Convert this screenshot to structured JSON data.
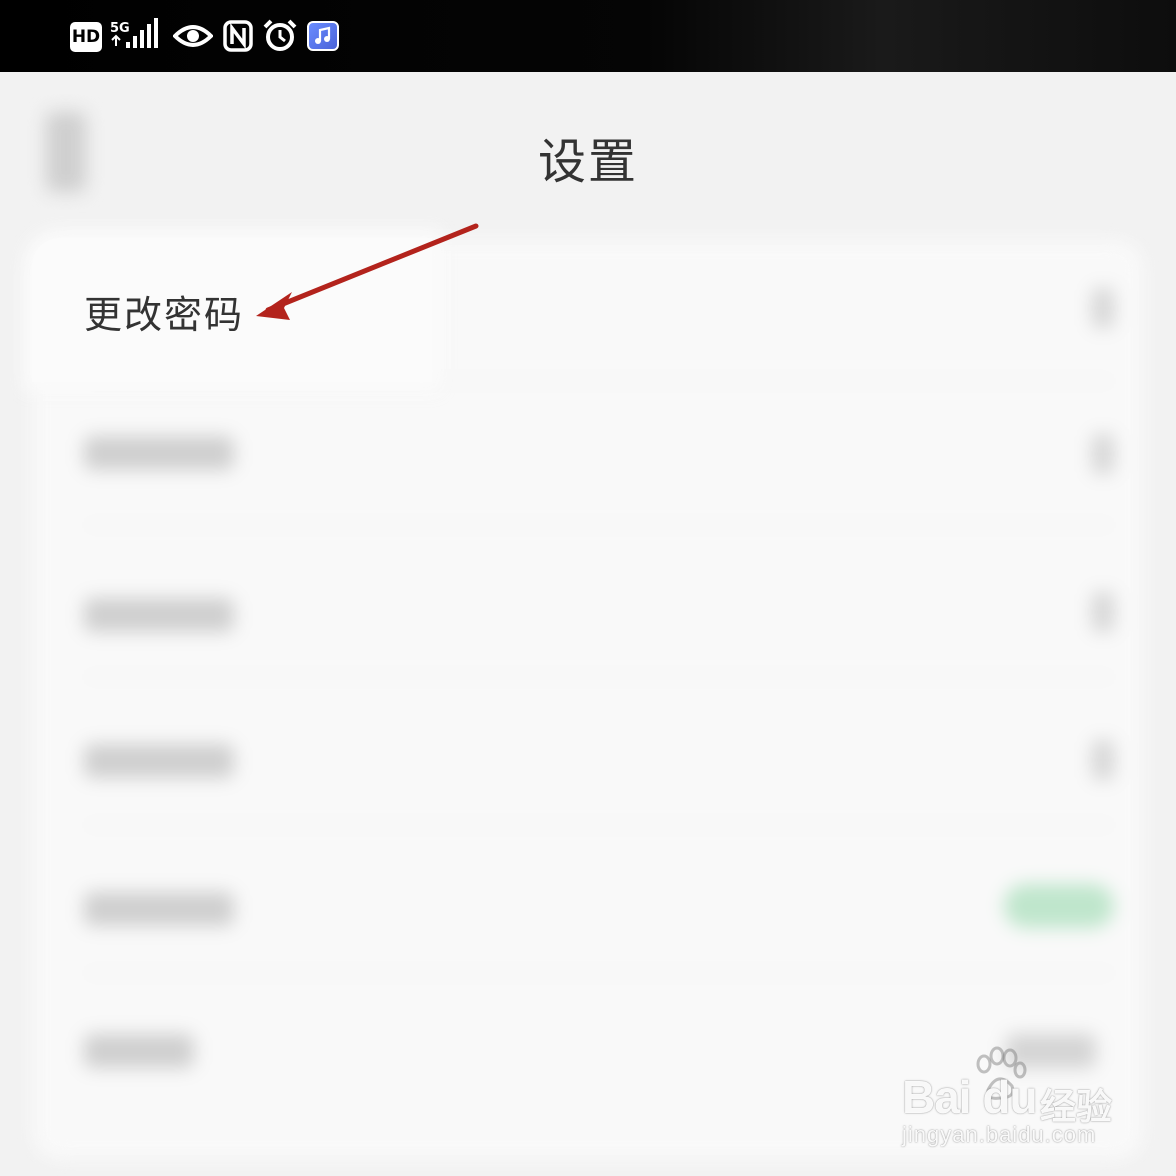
{
  "status_bar": {
    "hd_label": "HD",
    "network_label": "5G",
    "icons": [
      "hd-icon",
      "signal-icon",
      "eye-icon",
      "nfc-icon",
      "alarm-icon",
      "music-app-icon"
    ]
  },
  "header": {
    "title": "设置"
  },
  "settings": {
    "highlighted_item": {
      "label": "更改密码"
    }
  },
  "annotation": {
    "arrow_color": "#b3231c"
  },
  "watermark": {
    "brand": "Bai du",
    "sub": "经验",
    "url": "jingyan.baidu.com"
  },
  "colors": {
    "background": "#f2f2f2",
    "card": "#fbfbfb",
    "text": "#333333",
    "toggle_on": "#bfe6cc"
  }
}
